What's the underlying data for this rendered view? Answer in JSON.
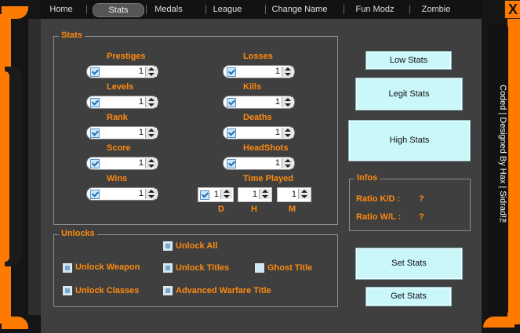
{
  "window": {
    "close_glyph": "X",
    "credit": "Coded | Designed By Hax | Sidrad!™"
  },
  "tabs": [
    {
      "label": "Home",
      "active": false
    },
    {
      "label": "Stats",
      "active": true
    },
    {
      "label": "Medals",
      "active": false
    },
    {
      "label": "League",
      "active": false
    },
    {
      "label": "Change Name",
      "active": false
    },
    {
      "label": "Fun Modz",
      "active": false
    },
    {
      "label": "Zombie",
      "active": false
    }
  ],
  "stats": {
    "title": "Stats",
    "prestiges": {
      "label": "Prestiges",
      "value": "1"
    },
    "levels": {
      "label": "Levels",
      "value": "1"
    },
    "rank": {
      "label": "Rank",
      "value": "1"
    },
    "score": {
      "label": "Score",
      "value": "1"
    },
    "wins": {
      "label": "Wins",
      "value": "1"
    },
    "losses": {
      "label": "Losses",
      "value": "1"
    },
    "kills": {
      "label": "Kills",
      "value": "1"
    },
    "deaths": {
      "label": "Deaths",
      "value": "1"
    },
    "headshots": {
      "label": "HeadShots",
      "value": "1"
    },
    "time_played": {
      "label": "Time Played",
      "days": {
        "unit": "D",
        "value": "1"
      },
      "hours": {
        "unit": "H",
        "value": "1"
      },
      "minutes": {
        "unit": "M",
        "value": "1"
      }
    }
  },
  "presets": {
    "low": "Low Stats",
    "legit": "Legit Stats",
    "high": "High Stats"
  },
  "infos": {
    "title": "Infos",
    "kd_label": "Ratio K/D :",
    "kd_value": "?",
    "wl_label": "Ratio W/L :",
    "wl_value": "?"
  },
  "unlocks": {
    "title": "Unlocks",
    "unlock_all": "Unlock All",
    "unlock_weapon": "Unlock Weapon",
    "unlock_titles": "Unlock Titles",
    "ghost_title": "Ghost Title",
    "unlock_classes": "Unlock Classes",
    "advanced_warfare_title": "Advanced Warfare Title"
  },
  "actions": {
    "set": "Set Stats",
    "get": "Get Stats"
  }
}
